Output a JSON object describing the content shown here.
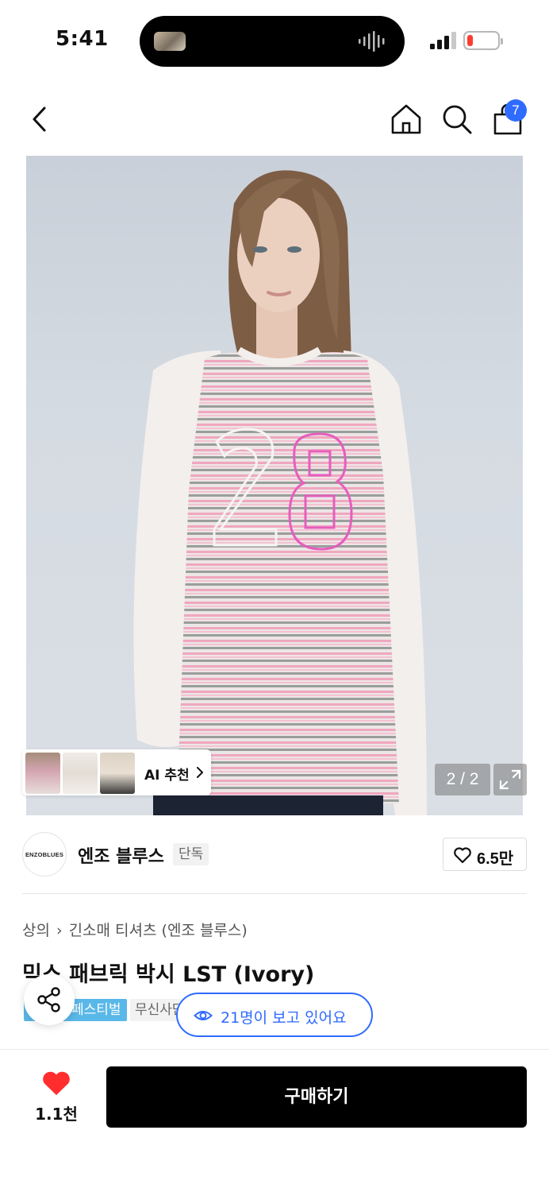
{
  "status_bar": {
    "time": "5:41"
  },
  "nav": {
    "cart_count": "7"
  },
  "gallery": {
    "ai_recommend_label": "AI 추천",
    "page_counter": "2 / 2"
  },
  "brand": {
    "logo_text": "ENZOBLUES",
    "name": "엔조 블루스",
    "exclusive_tag": "단독",
    "like_count": "6.5만"
  },
  "product": {
    "breadcrumb": [
      "상의",
      "긴소매 티셔츠 (엔조 블루스)"
    ],
    "title": "믹스 패브릭 박시 LST (Ivory)",
    "tags": [
      "페스티벌",
      "무신사단독"
    ],
    "viewers_text": "21명이 보고 있어요"
  },
  "bottom_bar": {
    "like_count": "1.1천",
    "buy_label": "구매하기"
  },
  "colors": {
    "accent": "#2f6bff",
    "like_red": "#ff2d2d",
    "festival_tag": "#5ab8e8"
  }
}
